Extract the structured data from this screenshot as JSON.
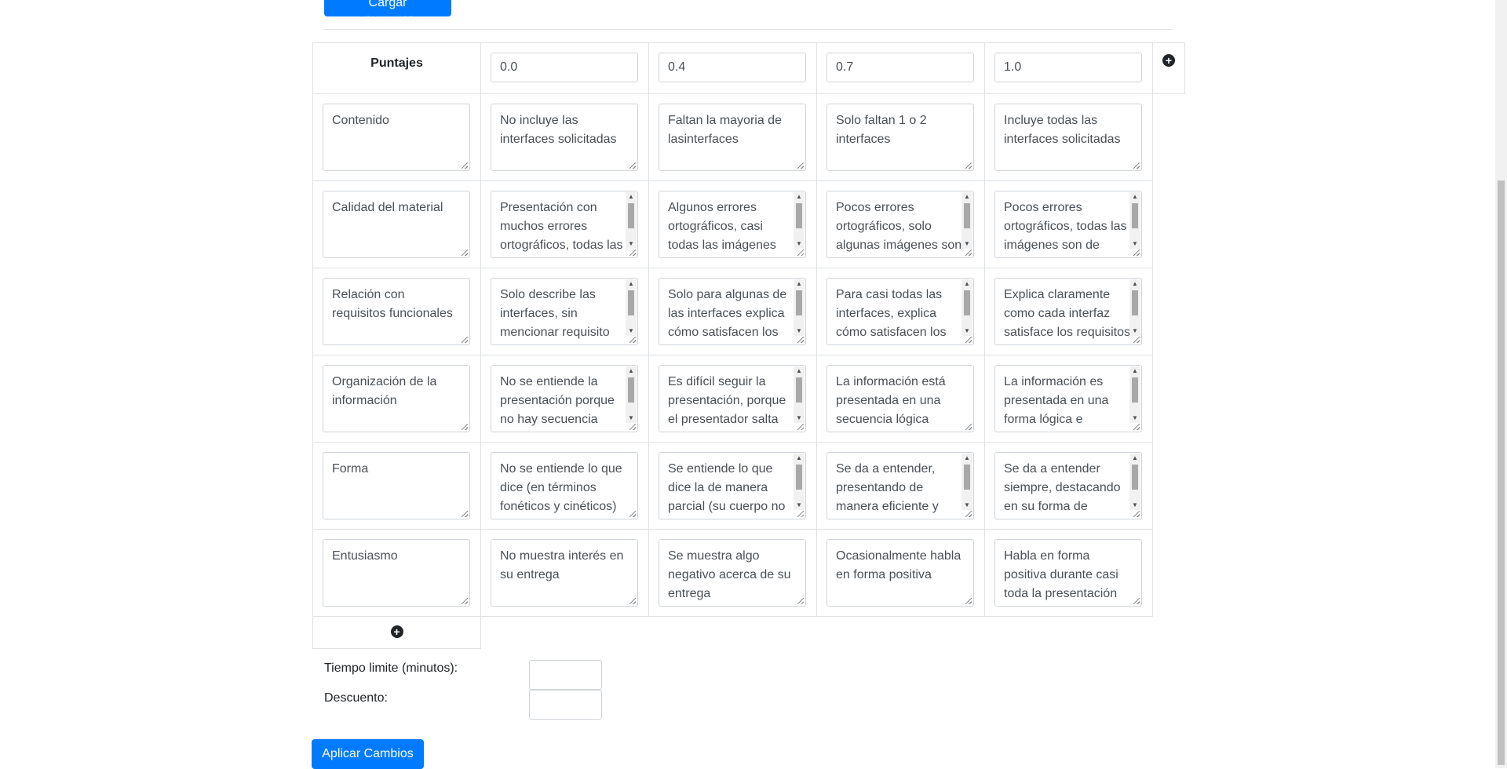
{
  "actions": {
    "load_label": "Cargar Información",
    "apply_label": "Aplicar Cambios"
  },
  "rubric": {
    "header_label": "Puntajes",
    "scores": [
      "0.0",
      "0.4",
      "0.7",
      "1.0"
    ],
    "rows": [
      {
        "criterion": "Contenido",
        "levels": [
          "No incluye las interfaces solicitadas",
          "Faltan la mayoria de lasinterfaces",
          "Solo faltan 1 o 2 interfaces",
          "Incluye todas las interfaces solicitadas"
        ]
      },
      {
        "criterion": "Calidad del material",
        "levels": [
          "Presentación con muchos errores ortográficos, todas las imágenes son de baja calidad",
          "Algunos errores ortográficos, casi todas las imágenes son de baja calidad",
          "Pocos errores ortográficos, solo algunas imágenes son de baja calidad",
          "Pocos errores ortográficos, todas las imágenes son de buena resolución"
        ]
      },
      {
        "criterion": "Relación con requisitos funcionales",
        "levels": [
          "Solo describe las interfaces, sin mencionar requisito alguno",
          "Solo para algunas de las interfaces explica cómo satisfacen los requisitos",
          "Para casi todas las interfaces, explica cómo satisfacen los requisitos",
          "Explica claramente como cada interfaz satisface los requisitos"
        ]
      },
      {
        "criterion": "Organización de la información",
        "levels": [
          "No se entiende la presentación porque no hay secuencia lógica de la información",
          "Es difícil seguir la presentación, porque el presentador salta de un tema a otro",
          "La información está presentada en una secuencia lógica",
          "La información es presentada en una forma lógica e interesante"
        ]
      },
      {
        "criterion": "Forma",
        "levels": [
          "No se entiende lo que dice (en términos fonéticos y cinéticos)",
          "Se entiende lo que dice la de manera parcial (su cuerpo no acompaña su discurso)",
          "Se da a entender, presentando de manera eficiente y coherente todo el contenido",
          "Se da a entender siempre, destacando en su forma de presentar"
        ]
      },
      {
        "criterion": "Entusiasmo",
        "levels": [
          "No muestra interés en su entrega",
          "Se muestra algo negativo acerca de su entrega",
          "Ocasionalmente habla en forma positiva",
          "Habla en forma positiva durante casi toda la presentación"
        ]
      }
    ]
  },
  "settings": {
    "time_limit_label": "Tiempo limite (minutos):",
    "time_limit_value": "",
    "discount_label": "Descuento:",
    "discount_value": ""
  },
  "icons": {
    "add_column": "plus-circle-icon",
    "add_row": "plus-circle-icon"
  },
  "colors": {
    "primary": "#007bff",
    "border": "#dee2e6",
    "input_border": "#ced4da"
  }
}
